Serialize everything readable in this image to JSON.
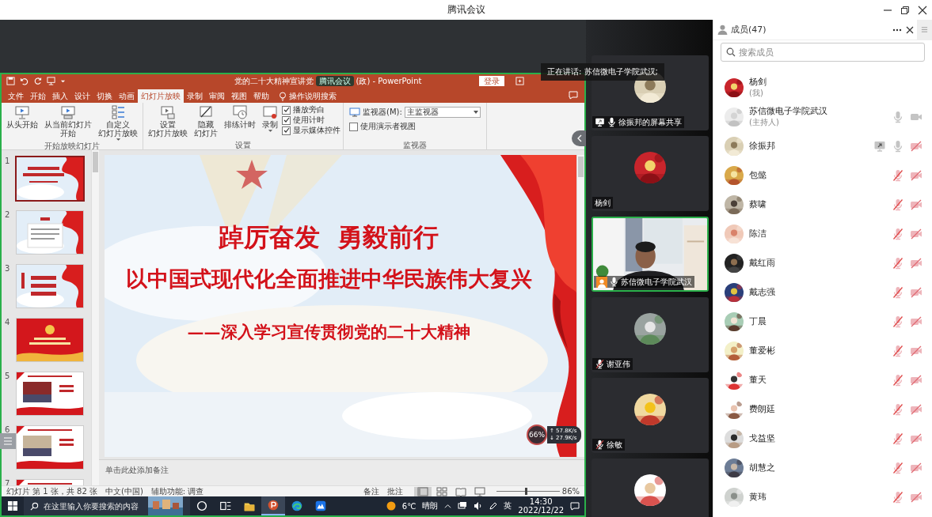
{
  "window": {
    "title": "腾讯会议"
  },
  "powerpoint": {
    "title_left": "党的二十大精神宣讲党",
    "overlay_badge": "腾讯会议",
    "title_right": "(政) - PowerPoint",
    "login_button": "登录",
    "tabs": [
      {
        "label": "文件",
        "selected": false
      },
      {
        "label": "开始",
        "selected": false
      },
      {
        "label": "插入",
        "selected": false
      },
      {
        "label": "设计",
        "selected": false
      },
      {
        "label": "切换",
        "selected": false
      },
      {
        "label": "动画",
        "selected": false
      },
      {
        "label": "幻灯片放映",
        "selected": true
      },
      {
        "label": "录制",
        "selected": false
      },
      {
        "label": "审阅",
        "selected": false
      },
      {
        "label": "视图",
        "selected": false
      },
      {
        "label": "帮助",
        "selected": false
      }
    ],
    "tell_me": "操作说明搜索",
    "ribbon": [
      {
        "label": "开始放映幻灯片",
        "items": [
          {
            "kind": "button",
            "lines": [
              "从头开始"
            ]
          },
          {
            "kind": "button",
            "lines": [
              "从当前幻灯片",
              "开始"
            ]
          },
          {
            "kind": "button",
            "lines": [
              "自定义",
              "幻灯片放映"
            ],
            "dropdown": true
          }
        ]
      },
      {
        "label": "设置",
        "items": [
          {
            "kind": "button",
            "lines": [
              "设置",
              "幻灯片放映"
            ]
          },
          {
            "kind": "button",
            "lines": [
              "隐藏",
              "幻灯片"
            ]
          },
          {
            "kind": "button",
            "lines": [
              "排练计时"
            ]
          },
          {
            "kind": "button",
            "lines": [
              "录制"
            ],
            "dropdown": true
          },
          {
            "kind": "checklist",
            "checks": [
              {
                "label": "播放旁白",
                "checked": true
              },
              {
                "label": "使用计时",
                "checked": true
              },
              {
                "label": "显示媒体控件",
                "checked": true
              }
            ]
          }
        ]
      },
      {
        "label": "监视器",
        "items": [
          {
            "kind": "select",
            "label": "监视器(M):",
            "value": "主监视器"
          },
          {
            "kind": "checklist",
            "checks": [
              {
                "label": "使用演示者视图",
                "checked": false
              }
            ]
          }
        ]
      }
    ],
    "thumbnails": [
      {
        "number": "1",
        "selected": true
      },
      {
        "number": "2",
        "selected": false
      },
      {
        "number": "3",
        "selected": false
      },
      {
        "number": "4",
        "selected": false
      },
      {
        "number": "5",
        "selected": false
      },
      {
        "number": "6",
        "selected": false
      },
      {
        "number": "7",
        "selected": false
      }
    ],
    "slide": {
      "title": "踔厉奋发  勇毅前行",
      "subtitle": "以中国式现代化全面推进中华民族伟大复兴",
      "tagline": "——深入学习宣传贯彻党的二十大精神"
    },
    "notes": {
      "placeholder": "单击此处添加备注"
    },
    "status": {
      "slide_info": "幻灯片 第 1 张，共 82 张",
      "language": "中文(中国)",
      "accessibility": "辅助功能: 调查",
      "notes_button": "备注",
      "comments_button": "批注",
      "views": [
        {
          "selected": true
        },
        {
          "selected": false
        },
        {
          "selected": false
        },
        {
          "selected": false
        }
      ],
      "zoom": {
        "level": 0.45,
        "reading": "86%"
      }
    }
  },
  "taskbar": {
    "search_placeholder": "在这里输入你要搜索的内容",
    "apps": [
      {
        "selected": false
      },
      {
        "selected": false
      },
      {
        "selected": false
      },
      {
        "selected": true
      },
      {
        "selected": false
      },
      {
        "selected": false
      }
    ],
    "temperature": "6℃",
    "weather": "晴朗",
    "input_method": "英",
    "time": "14:30",
    "date": "2022/12/22"
  },
  "speaking": {
    "label": "正在讲话: 苏信微电子学院武汉;"
  },
  "network": {
    "percent": "66%",
    "upload": "↑ 57.8K/s",
    "download": "↓ 27.9K/s"
  },
  "videos": [
    {
      "name": "徐振邦的屏幕共享",
      "kind": "avatar",
      "speaking": false,
      "icons": [
        {
          "kind": "screen_share"
        },
        {
          "kind": "mic",
          "muted": false
        }
      ]
    },
    {
      "name": "杨剑",
      "kind": "avatar",
      "speaking": false
    },
    {
      "name": "苏信微电子学院武汉",
      "kind": "camera",
      "speaking": true,
      "icons": [
        {
          "kind": "host"
        },
        {
          "kind": "mic",
          "muted": false
        }
      ]
    },
    {
      "name": "谢亚伟",
      "kind": "avatar",
      "speaking": false,
      "icons": [
        {
          "kind": "mic",
          "muted": true
        }
      ]
    },
    {
      "name": "徐敏",
      "kind": "avatar",
      "speaking": false,
      "icons": [
        {
          "kind": "mic",
          "muted": true
        }
      ]
    },
    {
      "kind": "avatar",
      "speaking": false
    }
  ],
  "members": {
    "title": "成员(47)",
    "search": {
      "placeholder": "搜索成员"
    },
    "list": [
      {
        "name": "杨剑",
        "role": "(我)"
      },
      {
        "name": "苏信微电子学院武汉",
        "role": "(主持人)",
        "icons": [
          {
            "kind": "mic",
            "muted": false
          },
          {
            "kind": "camera",
            "muted": false
          }
        ]
      },
      {
        "name": "徐振邦",
        "icons": [
          {
            "kind": "screen_share"
          },
          {
            "kind": "mic",
            "muted": false
          },
          {
            "kind": "camera",
            "muted": true
          }
        ]
      },
      {
        "name": "包懿",
        "icons": [
          {
            "kind": "mic",
            "muted": true
          },
          {
            "kind": "camera",
            "muted": true
          }
        ]
      },
      {
        "name": "蔡啸",
        "icons": [
          {
            "kind": "mic",
            "muted": true
          },
          {
            "kind": "camera",
            "muted": true
          }
        ]
      },
      {
        "name": "陈洁",
        "icons": [
          {
            "kind": "mic",
            "muted": true
          },
          {
            "kind": "camera",
            "muted": true
          }
        ]
      },
      {
        "name": "戴红雨",
        "icons": [
          {
            "kind": "mic",
            "muted": true
          },
          {
            "kind": "camera",
            "muted": true
          }
        ]
      },
      {
        "name": "戴志强",
        "icons": [
          {
            "kind": "mic",
            "muted": true
          },
          {
            "kind": "camera",
            "muted": true
          }
        ]
      },
      {
        "name": "丁晨",
        "icons": [
          {
            "kind": "mic",
            "muted": true
          },
          {
            "kind": "camera",
            "muted": true
          }
        ]
      },
      {
        "name": "董爱彬",
        "icons": [
          {
            "kind": "mic",
            "muted": true
          },
          {
            "kind": "camera",
            "muted": true
          }
        ]
      },
      {
        "name": "董天",
        "icons": [
          {
            "kind": "mic",
            "muted": true
          },
          {
            "kind": "camera",
            "muted": true
          }
        ]
      },
      {
        "name": "费朗廷",
        "icons": [
          {
            "kind": "mic",
            "muted": true
          },
          {
            "kind": "camera",
            "muted": true
          }
        ]
      },
      {
        "name": "戈益坚",
        "icons": [
          {
            "kind": "mic",
            "muted": true
          },
          {
            "kind": "camera",
            "muted": true
          }
        ]
      },
      {
        "name": "胡慧之",
        "icons": [
          {
            "kind": "mic",
            "muted": true
          },
          {
            "kind": "camera",
            "muted": true
          }
        ]
      },
      {
        "name": "黄玮",
        "icons": [
          {
            "kind": "mic",
            "muted": true
          },
          {
            "kind": "camera",
            "muted": true
          }
        ]
      }
    ]
  }
}
